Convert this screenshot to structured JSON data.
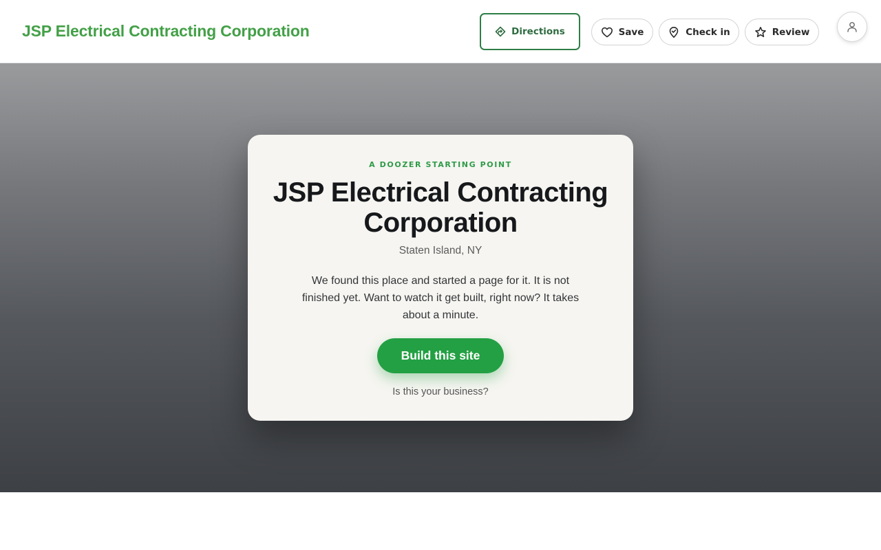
{
  "header": {
    "brand": "JSP Electrical Contracting Corporation",
    "actions": {
      "directions": "Directions",
      "save": "Save",
      "check_in": "Check in",
      "review": "Review"
    },
    "icons": [
      "directions-icon",
      "heart-icon",
      "map-pin-icon",
      "star-icon",
      "user-icon"
    ]
  },
  "card": {
    "eyebrow": "A DOOZER STARTING POINT",
    "title": "JSP Electrical Contracting Corporation",
    "location": "Staten Island, NY",
    "blurb": "We found this place and started a page for it. It is not finished yet. Want to watch it get built, right now? It takes about a minute.",
    "cta": "Build this site",
    "claim_link": "Is this your business?"
  },
  "colors": {
    "brand_green": "#43a047",
    "cta_green": "#23a043",
    "directions_border": "#2e7d46",
    "card_bg": "#f6f5f1"
  }
}
